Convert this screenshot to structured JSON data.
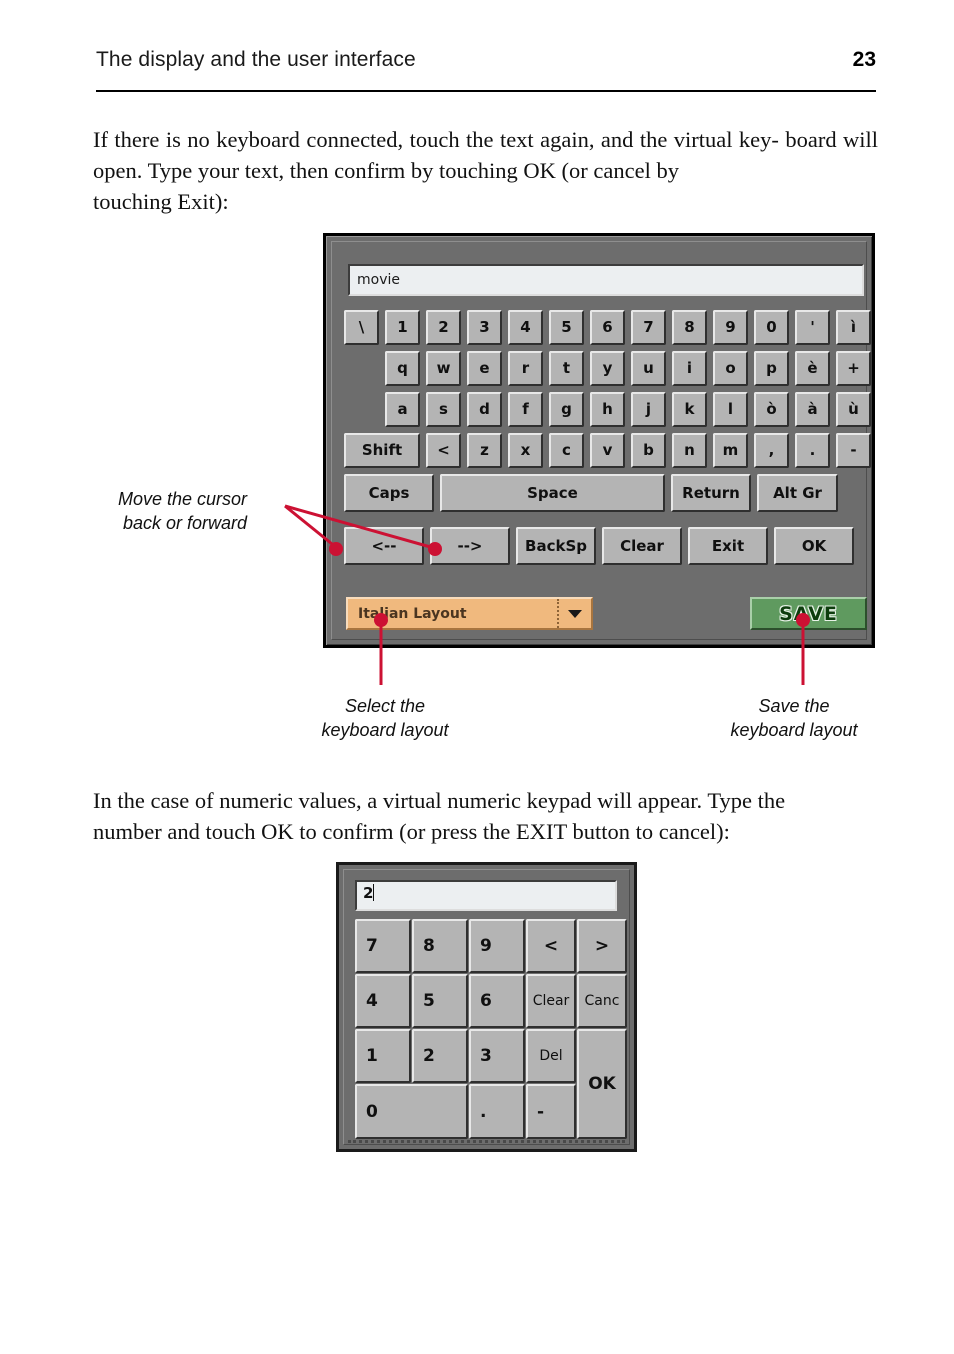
{
  "header": {
    "title": "The display and the user interface",
    "page_number": "23"
  },
  "paragraphs": {
    "p1_line1": "If there is no keyboard connected, touch the text again, and the virtual key-",
    "p1_line2": "board will open. Type your text, then confirm by touching OK (or cancel by",
    "p1_line3": "touching Exit):",
    "p2_line1": "In the case of numeric values, a virtual numeric keypad will appear. Type the",
    "p2_line2": "number and touch OK to confirm (or press the EXIT button to cancel):"
  },
  "keyboard": {
    "text_value": "movie",
    "row1": [
      "\\",
      "1",
      "2",
      "3",
      "4",
      "5",
      "6",
      "7",
      "8",
      "9",
      "0",
      "'",
      "ì"
    ],
    "row2": [
      "q",
      "w",
      "e",
      "r",
      "t",
      "y",
      "u",
      "i",
      "o",
      "p",
      "è",
      "+"
    ],
    "row3": [
      "a",
      "s",
      "d",
      "f",
      "g",
      "h",
      "j",
      "k",
      "l",
      "ò",
      "à",
      "ù"
    ],
    "row4": [
      "Shift",
      "<",
      "z",
      "x",
      "c",
      "v",
      "b",
      "n",
      "m",
      ",",
      ".",
      "-"
    ],
    "row5": [
      "Caps",
      "Space",
      "Return",
      "Alt Gr"
    ],
    "row6": [
      "<--",
      "-->",
      "BackSp",
      "Clear",
      "Exit",
      "OK"
    ],
    "layout_select_value": "Italian Layout",
    "save_label": "SAVE",
    "colors": {
      "panel": "#6d6d6d",
      "key": "#b4b4b4",
      "dropdown": "#f0b97e",
      "save": "#5f9a5f",
      "save_text": "#0d3d0d",
      "field": "#eceff1",
      "callout": "#cc1133"
    }
  },
  "keypad": {
    "display_value": "2",
    "r1": [
      "7",
      "8",
      "9",
      "<",
      ">"
    ],
    "r2": [
      "4",
      "5",
      "6",
      "Clear",
      "Canc"
    ],
    "r3": [
      "1",
      "2",
      "3",
      "Del"
    ],
    "r4": [
      "0",
      ".",
      "-"
    ],
    "ok_label": "OK"
  },
  "callouts": {
    "cursor_l1": "Move the cursor",
    "cursor_l2": "back or forward",
    "select_l1": "Select the",
    "select_l2": "keyboard layout",
    "save_l1": "Save the",
    "save_l2": "keyboard layout"
  }
}
